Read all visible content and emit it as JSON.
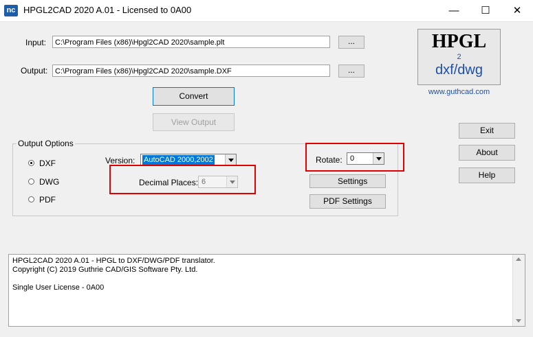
{
  "window": {
    "title": "HPGL2CAD 2020 A.01 - Licensed to 0A00",
    "icon_text": "nc",
    "min": "—",
    "max": "☐",
    "close": "✕"
  },
  "input": {
    "label": "Input:",
    "value": "C:\\Program Files (x86)\\Hpgl2CAD 2020\\sample.plt",
    "browse": "..."
  },
  "output": {
    "label": "Output:",
    "value": "C:\\Program Files (x86)\\Hpgl2CAD 2020\\sample.DXF",
    "browse": "..."
  },
  "actions": {
    "convert": "Convert",
    "view_output": "View Output"
  },
  "logo": {
    "line1": "HPGL",
    "line2": "2",
    "line3": "dxf/dwg",
    "url": "www.guthcad.com"
  },
  "side_buttons": {
    "exit": "Exit",
    "about": "About",
    "help": "Help"
  },
  "output_options": {
    "legend": "Output Options",
    "formats": [
      "DXF",
      "DWG",
      "PDF"
    ],
    "selected_format": "DXF",
    "version_label": "Version:",
    "version_value": "AutoCAD 2000,2002",
    "decimal_label": "Decimal Places:",
    "decimal_value": "6",
    "rotate_label": "Rotate:",
    "rotate_value": "0",
    "settings": "Settings",
    "pdf_settings": "PDF Settings"
  },
  "status": {
    "lines": [
      "HPGL2CAD 2020 A.01 - HPGL to DXF/DWG/PDF translator.",
      "Copyright (C) 2019 Guthrie CAD/GIS Software Pty. Ltd.",
      "",
      "Single User License - 0A00"
    ]
  },
  "colors": {
    "highlight": "#e00000",
    "selection": "#0078d7",
    "logo_blue": "#1a4fb0"
  }
}
